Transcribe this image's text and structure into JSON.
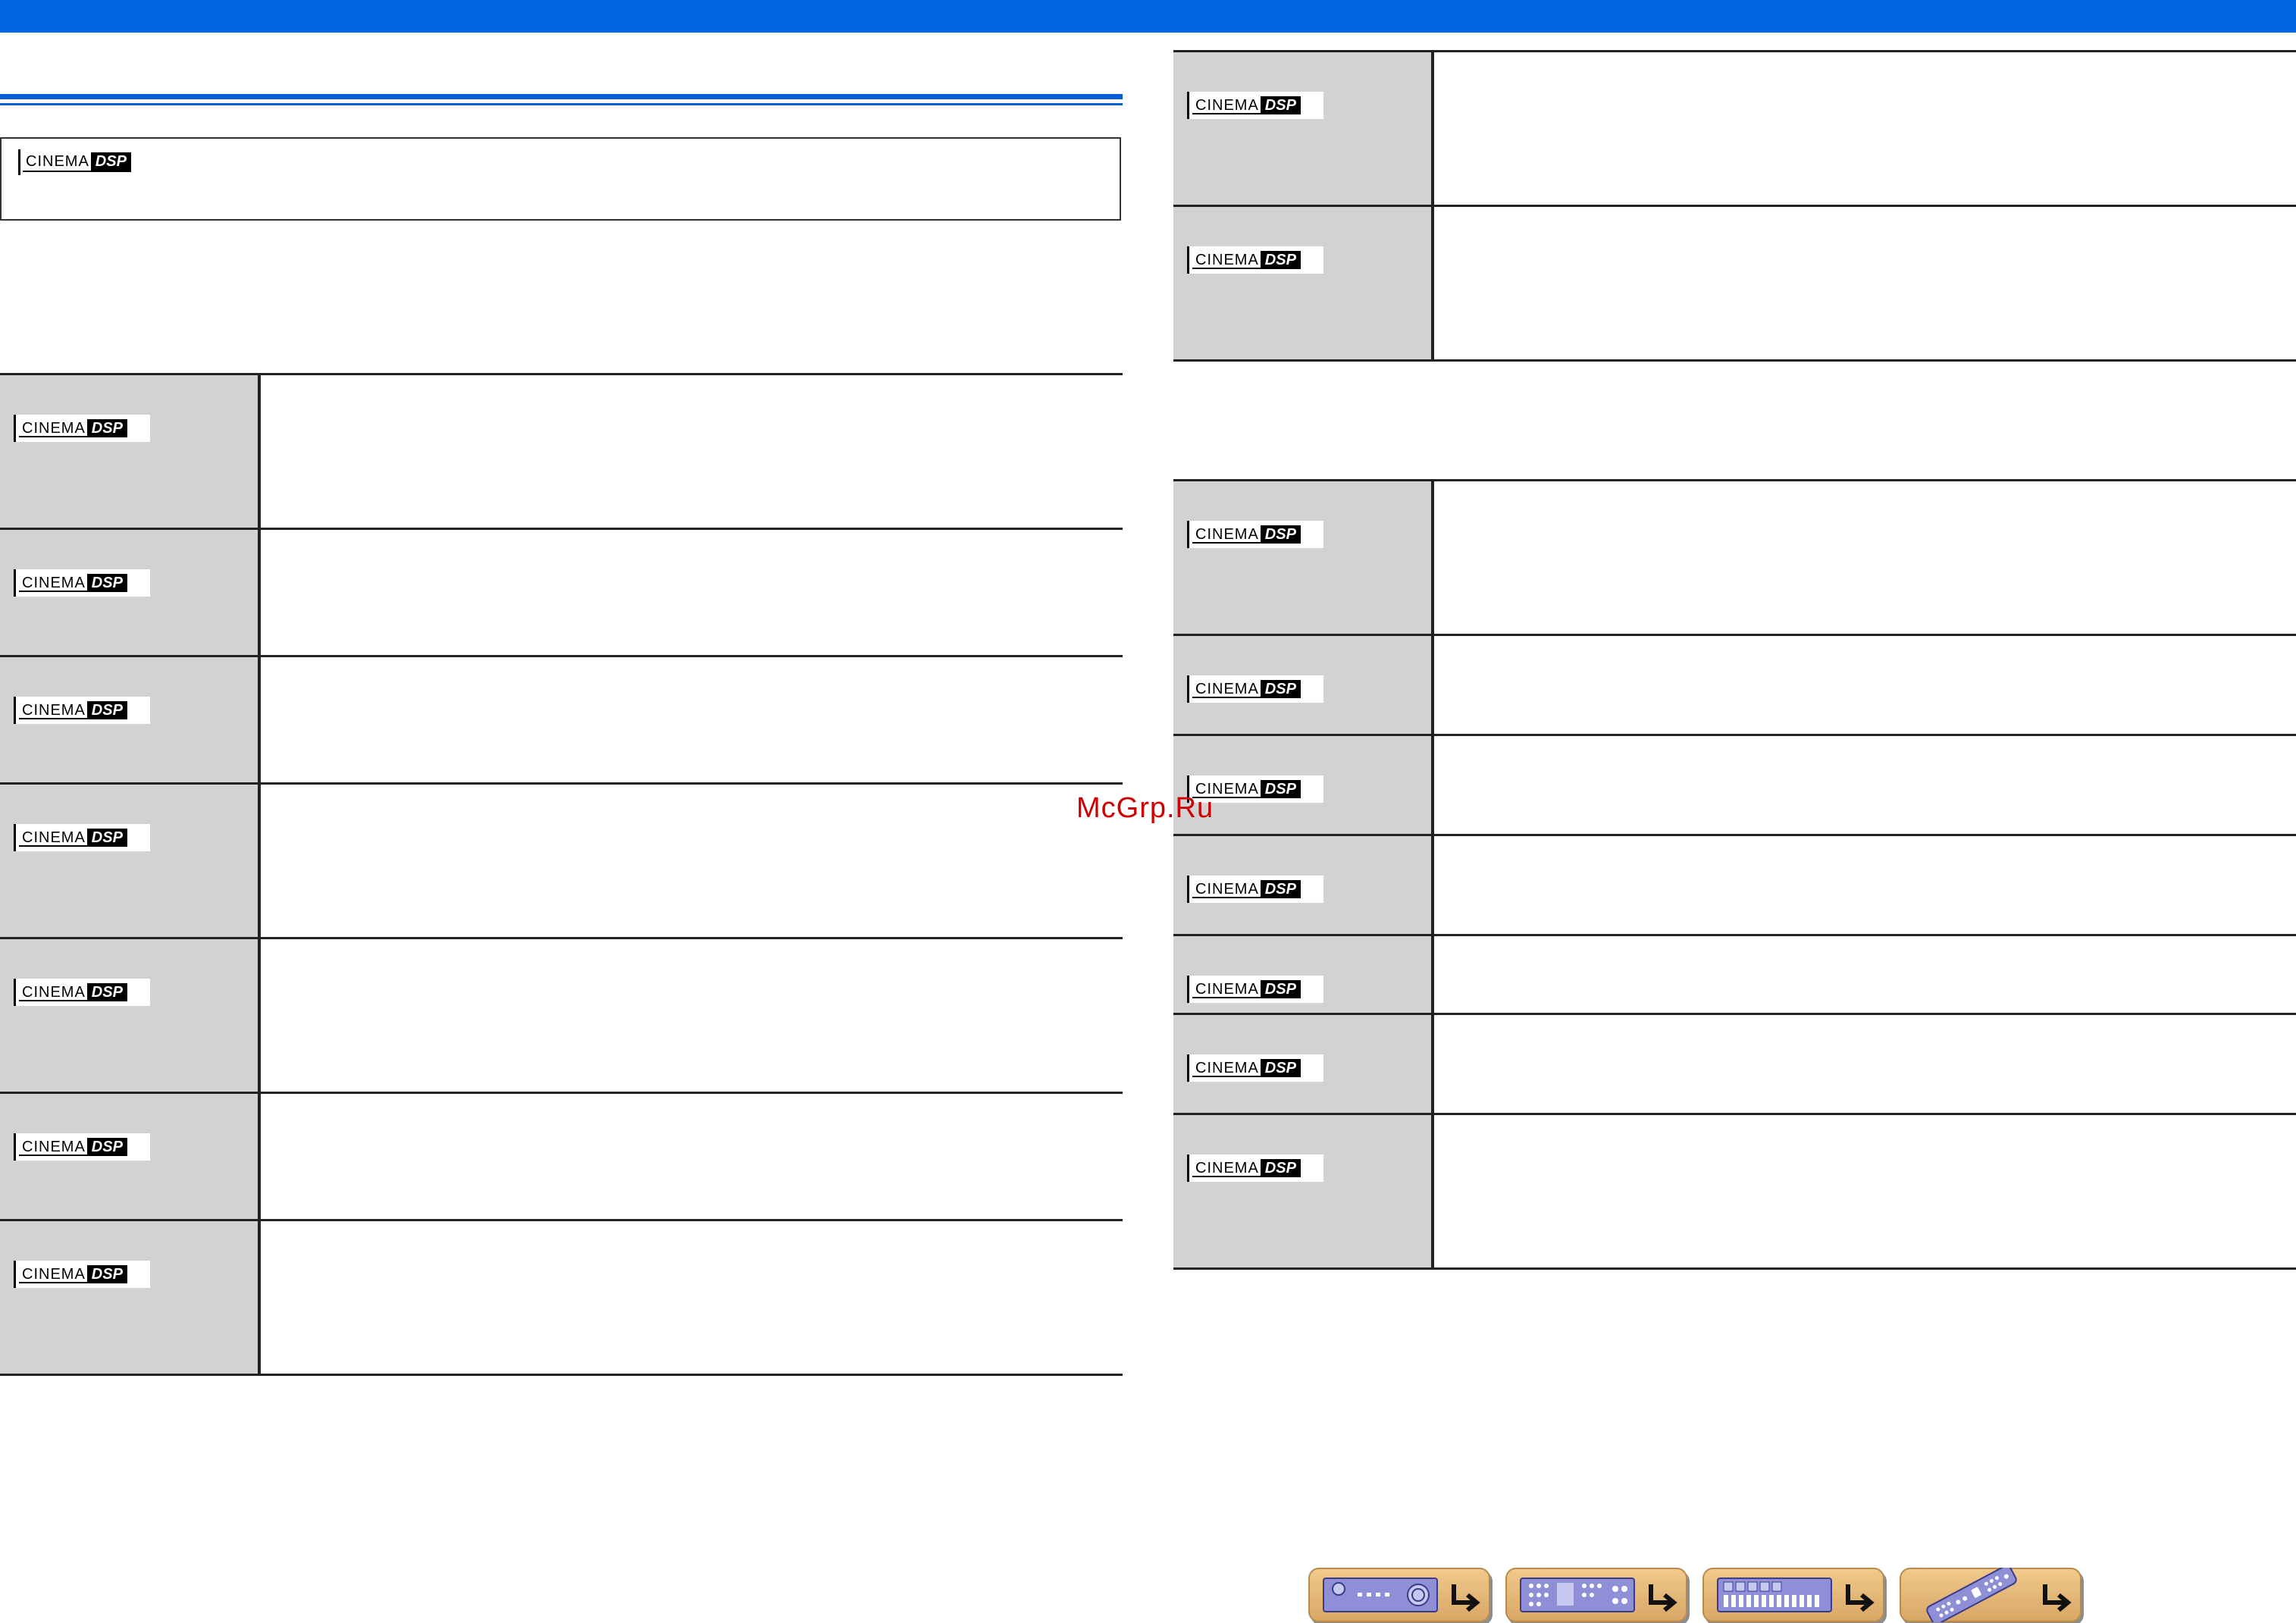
{
  "header": {
    "bar_color": "#0066e0"
  },
  "logo": {
    "part1": "CINEMA",
    "part2": "DSP"
  },
  "watermark": {
    "text": "McGrp.Ru",
    "color": "#cc0000"
  },
  "colors": {
    "row_fill": "#d2d2d2",
    "rule": "#222222",
    "nav_button": "#e8b877",
    "accent_blue": "#0a5fd8"
  },
  "nav_buttons": [
    {
      "icon": "receiver-front-panel-icon"
    },
    {
      "icon": "receiver-rear-panel-icon"
    },
    {
      "icon": "receiver-display-icon"
    },
    {
      "icon": "remote-control-icon"
    }
  ]
}
